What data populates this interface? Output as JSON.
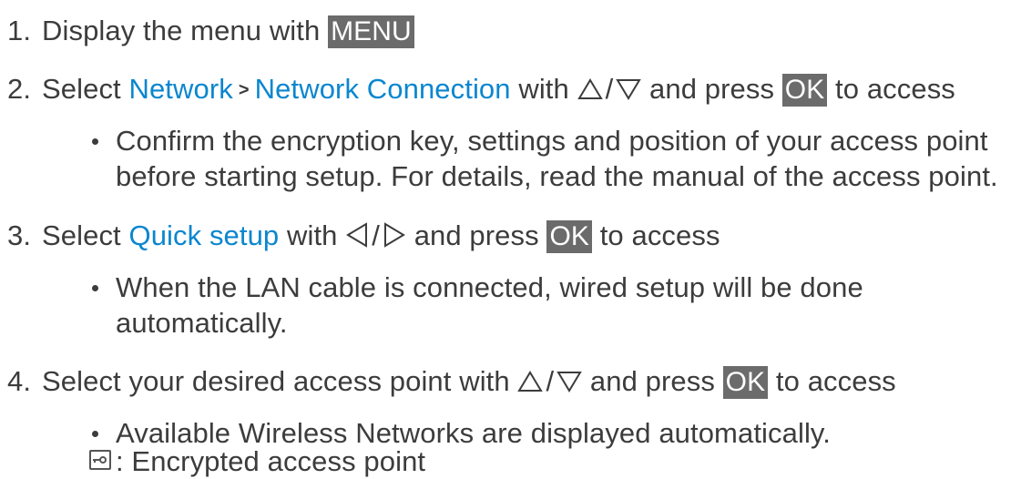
{
  "steps": [
    {
      "number": "1.",
      "text": "Display the menu with",
      "key": "MENU"
    },
    {
      "number": "2.",
      "pre": "Select",
      "link1": "Network",
      "link2": "Network Connection",
      "mid": "with",
      "slash": "/",
      "post": "and press",
      "key": "OK",
      "end": "to access"
    },
    {
      "number": "3.",
      "pre": "Select",
      "link": "Quick setup",
      "mid": "with",
      "slash": "/",
      "post": "and press",
      "key": "OK",
      "end": "to access"
    },
    {
      "number": "4.",
      "pre": "Select your desired access point with",
      "slash": "/",
      "post": "and press",
      "key": "OK",
      "end": "to access"
    }
  ],
  "notes": {
    "step2_line1": "Confirm the encryption key, settings and position of your access point",
    "step2_line2": "before starting setup. For details, read the manual of the access point.",
    "step3_line1": "When the LAN cable is connected, wired setup will be done",
    "step3_line2": "automatically.",
    "step4_line1": "Available Wireless Networks are displayed automatically."
  },
  "legend": {
    "icon": "encrypted-lock-icon",
    "text": ": Encrypted access point"
  },
  "colors": {
    "text": "#3c3c3c",
    "link": "#0b86cf",
    "key_bg": "#6b6b6b",
    "key_text": "#ffffff"
  }
}
